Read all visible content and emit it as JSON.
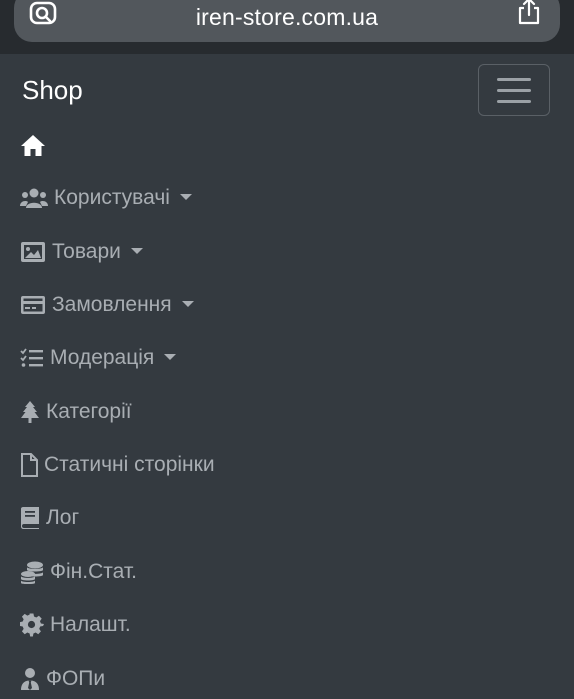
{
  "browser": {
    "url": "iren-store.com.ua"
  },
  "navbar": {
    "brand": "Shop",
    "items": [
      {
        "label": "",
        "icon": "home-icon"
      },
      {
        "label": "Користувачі",
        "icon": "users-icon",
        "dropdown": true
      },
      {
        "label": "Товари",
        "icon": "image-icon",
        "dropdown": true
      },
      {
        "label": "Замовлення",
        "icon": "credit-card-icon",
        "dropdown": true
      },
      {
        "label": "Модерація",
        "icon": "tasks-icon",
        "dropdown": true
      },
      {
        "label": "Категорії",
        "icon": "tree-icon"
      },
      {
        "label": "Статичні сторінки",
        "icon": "file-icon"
      },
      {
        "label": "Лог",
        "icon": "book-icon"
      },
      {
        "label": "Фін.Стат.",
        "icon": "coins-icon"
      },
      {
        "label": "Налашт.",
        "icon": "gear-icon"
      },
      {
        "label": "ФОПи",
        "icon": "user-tie-icon"
      }
    ]
  },
  "colors": {
    "navbar_bg": "#343a40",
    "link": "#a9aeb3",
    "brand": "#ffffff"
  }
}
